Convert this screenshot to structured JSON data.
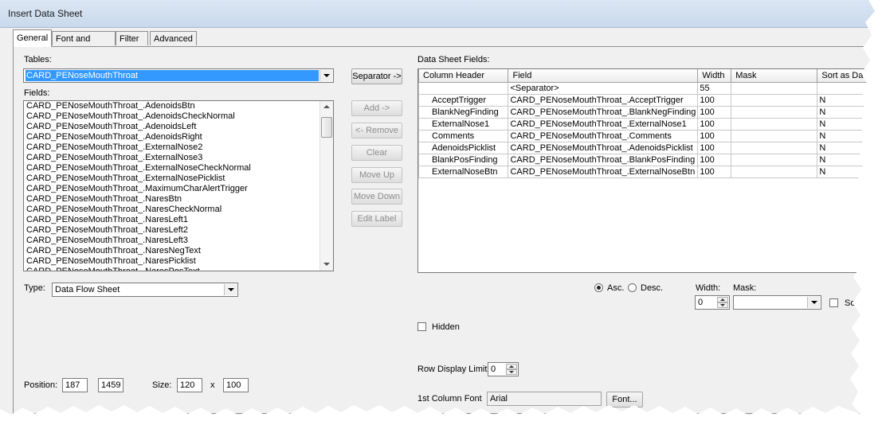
{
  "window": {
    "title": "Insert Data Sheet"
  },
  "tabs": [
    {
      "label": "General",
      "active": true
    },
    {
      "label": "Font and Color",
      "active": false
    },
    {
      "label": "Filter",
      "active": false
    },
    {
      "label": "Advanced",
      "active": false
    }
  ],
  "left": {
    "tables_label": "Tables:",
    "tables_value": "CARD_PENoseMouthThroat",
    "fields_label": "Fields:",
    "fields": [
      "CARD_PENoseMouthThroat_.AdenoidsBtn",
      "CARD_PENoseMouthThroat_.AdenoidsCheckNormal",
      "CARD_PENoseMouthThroat_.AdenoidsLeft",
      "CARD_PENoseMouthThroat_.AdenoidsRight",
      "CARD_PENoseMouthThroat_.ExternalNose2",
      "CARD_PENoseMouthThroat_.ExternalNose3",
      "CARD_PENoseMouthThroat_.ExternalNoseCheckNormal",
      "CARD_PENoseMouthThroat_.ExternalNosePicklist",
      "CARD_PENoseMouthThroat_.MaximumCharAlertTrigger",
      "CARD_PENoseMouthThroat_.NaresBtn",
      "CARD_PENoseMouthThroat_.NaresCheckNormal",
      "CARD_PENoseMouthThroat_.NaresLeft1",
      "CARD_PENoseMouthThroat_.NaresLeft2",
      "CARD_PENoseMouthThroat_.NaresLeft3",
      "CARD_PENoseMouthThroat_.NaresNegText",
      "CARD_PENoseMouthThroat_.NaresPicklist",
      "CARD_PENoseMouthThroat_.NaresPosText"
    ],
    "type_label": "Type:",
    "type_value": "Data Flow Sheet",
    "position_label": "Position:",
    "position_x": "187",
    "position_y": "1459",
    "size_label": "Size:",
    "size_w": "120",
    "size_x_sep": "x",
    "size_h": "100"
  },
  "buttons": {
    "separator": "Separator ->",
    "add": "Add ->",
    "remove": "<- Remove",
    "clear": "Clear",
    "move_up": "Move Up",
    "move_down": "Move Down",
    "edit_label": "Edit Label"
  },
  "grid": {
    "label": "Data Sheet Fields:",
    "columns": [
      "Column Header",
      "Field",
      "Width",
      "Mask",
      "Sort as Date"
    ],
    "rows": [
      [
        "",
        "<Separator>",
        "55",
        "",
        ""
      ],
      [
        "AcceptTrigger",
        "CARD_PENoseMouthThroat_.AcceptTrigger",
        "100",
        "",
        "N"
      ],
      [
        "BlankNegFinding",
        "CARD_PENoseMouthThroat_.BlankNegFinding",
        "100",
        "",
        "N"
      ],
      [
        "ExternalNose1",
        "CARD_PENoseMouthThroat_.ExternalNose1",
        "100",
        "",
        "N"
      ],
      [
        "Comments",
        "CARD_PENoseMouthThroat_.Comments",
        "100",
        "",
        "N"
      ],
      [
        "AdenoidsPicklist",
        "CARD_PENoseMouthThroat_.AdenoidsPicklist",
        "100",
        "",
        "N"
      ],
      [
        "BlankPosFinding",
        "CARD_PENoseMouthThroat_.BlankPosFinding",
        "100",
        "",
        "N"
      ],
      [
        "ExternalNoseBtn",
        "CARD_PENoseMouthThroat_.ExternalNoseBtn",
        "100",
        "",
        "N"
      ]
    ]
  },
  "right": {
    "asc_label": "Asc.",
    "desc_label": "Desc.",
    "width_label": "Width:",
    "width_value": "0",
    "mask_label": "Mask:",
    "mask_value": "",
    "sort_label": "Sort a",
    "hidden_label": "Hidden",
    "row_limit_label": "Row Display Limit:",
    "row_limit_value": "0",
    "first_col_font_label": "1st Column Font",
    "first_col_font_value": "Arial",
    "font_button": "Font..."
  }
}
